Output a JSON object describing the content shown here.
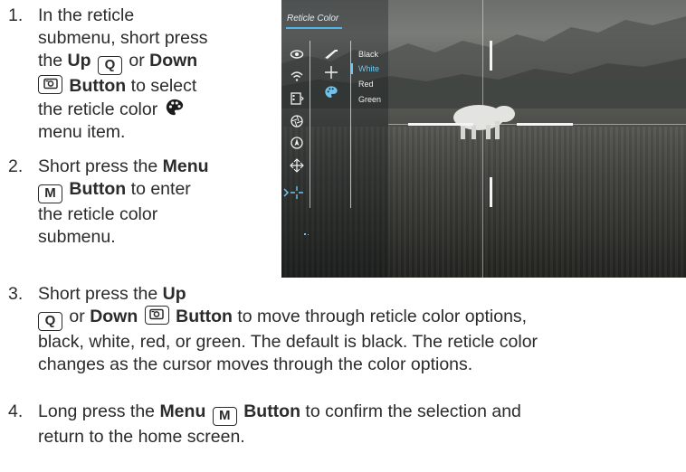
{
  "steps": [
    {
      "num": "1.",
      "p1": "In the reticle",
      "p2": "submenu, short press",
      "p3": "the ",
      "up_word": "Up",
      "up_key": "Q",
      "or1": " or ",
      "down_word": "Down",
      "down_key": "camera",
      "button_word": " Button",
      "p4": " to select",
      "p5": "the reticle color ",
      "p6": "menu item."
    },
    {
      "num": "2.",
      "p1": "Short press the ",
      "menu_word": "Menu",
      "menu_key": "M",
      "button_word": " Button",
      "p2": " to enter",
      "p3": "the reticle color",
      "p4": "submenu."
    },
    {
      "num": "3.",
      "p1": "Short press the ",
      "up_word": "Up",
      "up_key": "Q",
      "or1": " or ",
      "down_word": "Down",
      "down_key": "camera",
      "button_word": "Button",
      "p2": " to move through reticle color options,",
      "p3": "black, white, red, or green. The default is black. The reticle color",
      "p4": "changes as the cursor moves through the color options."
    },
    {
      "num": "4.",
      "p1": "Long press the ",
      "menu_word": "Menu",
      "menu_key": "M",
      "button_word": " Button",
      "p2": " to confirm the selection and",
      "p3": "return to the home screen."
    }
  ],
  "device_screen": {
    "menu_title": "Reticle Color",
    "options": [
      "Black",
      "White",
      "Red",
      "Green"
    ],
    "selected_option": "White",
    "accent_color": "#4fb6e6",
    "left_icons": [
      "eye-icon",
      "wifi-icon",
      "film-icon",
      "aperture-icon",
      "compass-icon",
      "move-icon",
      "reticle-icon"
    ],
    "submenu_icons": [
      "rifle-icon",
      "crosshair-icon",
      "palette-icon"
    ]
  }
}
